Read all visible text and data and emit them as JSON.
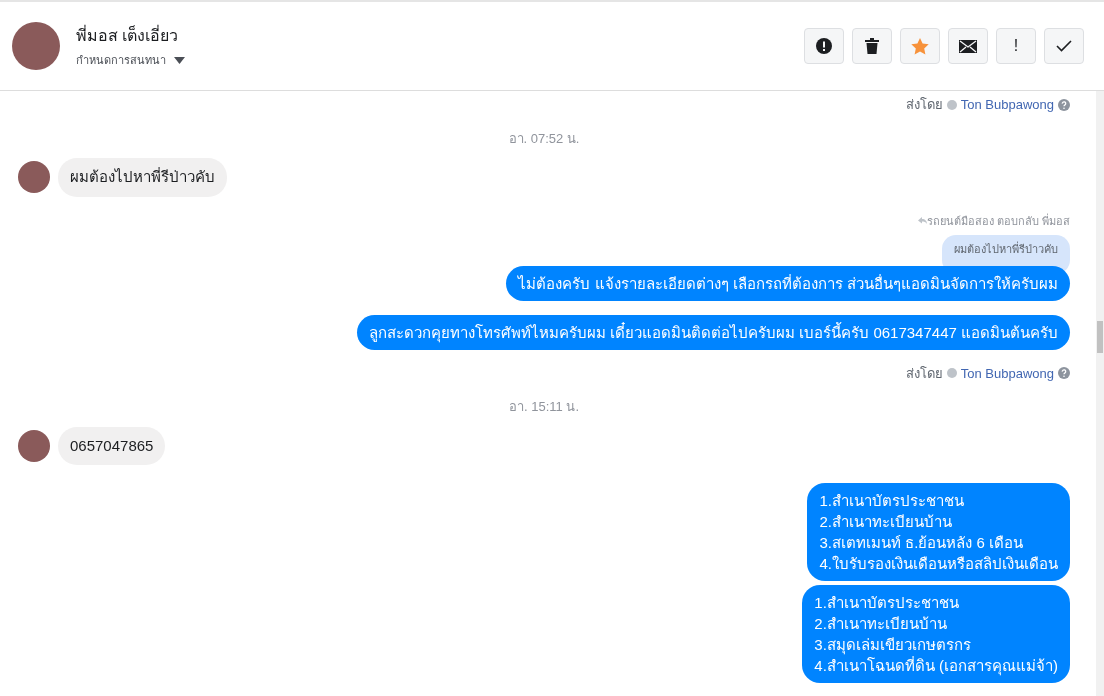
{
  "header": {
    "name": "พี่มอส เต็งเอี่ยว",
    "assign_label": "กำหนดการสนทนา"
  },
  "actions": [
    {
      "kind": "alert"
    },
    {
      "kind": "trash"
    },
    {
      "kind": "star"
    },
    {
      "kind": "mail"
    },
    {
      "kind": "exclaim",
      "text": "!"
    },
    {
      "kind": "check"
    }
  ],
  "messages": [
    {
      "kind": "sent_by",
      "label": "ส่งโดย",
      "author": "Ton Bubpawong"
    },
    {
      "kind": "time",
      "text": "อา. 07:52 น."
    },
    {
      "kind": "incoming",
      "text": "ผมต้องไปหาพี่รีป่าวคับ"
    },
    {
      "kind": "reply_note",
      "text": "รถยนต์มือสอง ตอบกลับ พี่มอส"
    },
    {
      "kind": "quoted",
      "text": "ผมต้องไปหาพี่รีป่าวคับ"
    },
    {
      "kind": "outgoing",
      "text": "ไม่ต้องครับ แจ้งรายละเอียดต่างๆ เลือกรถที่ต้องการ ส่วนอื่นๆแอดมินจัดการให้ครับผม"
    },
    {
      "kind": "outgoing",
      "text": "ลูกสะดวกคุยทางโทรศัพท์ไหมครับผม เดี๋ยวแอดมินติดต่อไปครับผม เบอร์นี้ครับ 0617347447 แอดมินต้นครับ"
    },
    {
      "kind": "sent_by",
      "label": "ส่งโดย",
      "author": "Ton Bubpawong"
    },
    {
      "kind": "time",
      "text": "อา. 15:11 น."
    },
    {
      "kind": "incoming",
      "text": "0657047865"
    },
    {
      "kind": "outgoing",
      "text": "1.สำเนาบัตรประชาชน\n2.สำเนาทะเบียนบ้าน\n3.สเตทเมนท์ ธ.ย้อนหลัง 6 เดือน\n4.ใบรับรองเงินเดือนหรือสลิปเงินเดือน"
    },
    {
      "kind": "outgoing",
      "text": "1.สำเนาบัตรประชาชน\n2.สำเนาทะเบียนบ้าน\n3.สมุดเล่มเขียวเกษตรกร\n4.สำเนาโฉนดที่ดิน (เอกสารคุณแม่จ้า)"
    }
  ]
}
